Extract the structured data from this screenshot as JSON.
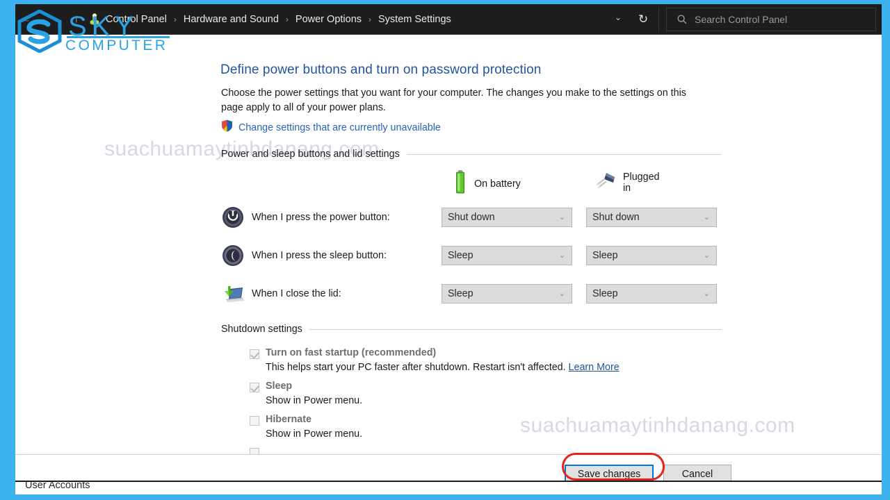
{
  "brand": {
    "name": "SKY",
    "subtitle": "COMPUTER",
    "accent": "#29a3e3"
  },
  "watermark": {
    "text": "suachuamaytinhdanang.com",
    "color": "#d8d8e4"
  },
  "titlebar": {
    "background": "#1d1d1d",
    "back_icon": "←",
    "forward_icon": "→",
    "recent_icon": "⌄",
    "up_icon": "↑",
    "control_panel_icon": "control-panel-icon",
    "dropdown_icon": "⌄",
    "refresh_icon": "↻",
    "breadcrumbs": [
      "Control Panel",
      "Hardware and Sound",
      "Power Options",
      "System Settings"
    ],
    "separator": "›",
    "search": {
      "placeholder": "Search Control Panel",
      "value": "",
      "icon": "search-icon"
    }
  },
  "page": {
    "title": "Define power buttons and turn on password protection",
    "title_color": "#22559c",
    "description": "Choose the power settings that you want for your computer. The changes you make to the settings on this page apply to all of your power plans.",
    "uac_link": "Change settings that are currently unavailable",
    "uac_link_color": "#2a64b4"
  },
  "sections": {
    "power": "Power and sleep buttons and lid settings",
    "shutdown": "Shutdown settings"
  },
  "columns": [
    {
      "label": "On battery",
      "icon": "battery-icon"
    },
    {
      "label": "Plugged in",
      "icon": "power-plug-icon"
    }
  ],
  "power_rows": [
    {
      "icon": "power-button-icon",
      "label": "When I press the power button:",
      "battery_value": "Shut down",
      "plugged_value": "Shut down",
      "disabled": true
    },
    {
      "icon": "sleep-button-icon",
      "label": "When I press the sleep button:",
      "battery_value": "Sleep",
      "plugged_value": "Sleep",
      "disabled": true
    },
    {
      "icon": "laptop-lid-icon",
      "label": "When I close the lid:",
      "battery_value": "Sleep",
      "plugged_value": "Sleep",
      "disabled": true
    }
  ],
  "combo_arrow": "⌄",
  "shutdown_items": [
    {
      "title": "Turn on fast startup (recommended)",
      "checked": true,
      "sub": "This helps start your PC faster after shutdown. Restart isn't affected. ",
      "link": "Learn More"
    },
    {
      "title": "Sleep",
      "checked": true,
      "sub": "Show in Power menu.",
      "link": ""
    },
    {
      "title": "Hibernate",
      "checked": false,
      "sub": "Show in Power menu.",
      "link": ""
    }
  ],
  "footer": {
    "save_label": "Save changes",
    "cancel_label": "Cancel",
    "highlight_color": "#e8211c",
    "focus_color": "#0078d7"
  },
  "bottom_strip": {
    "text": "User Accounts"
  }
}
